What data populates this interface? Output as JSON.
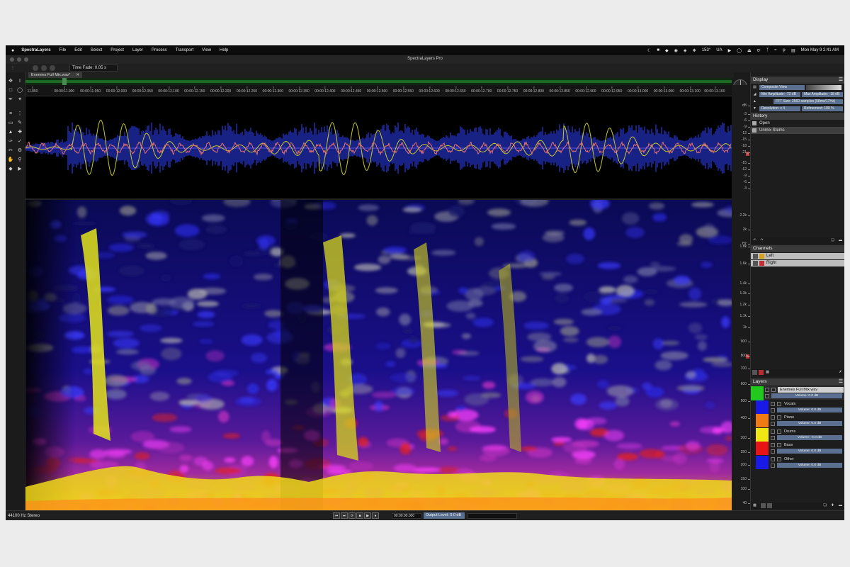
{
  "menubar": {
    "apple": "",
    "app": "SpectraLayers",
    "items": [
      "File",
      "Edit",
      "Select",
      "Project",
      "Layer",
      "Process",
      "Transport",
      "View",
      "Help"
    ],
    "status_temp": "153°",
    "status_input": "UA",
    "clock": "Mon May 9  2:41 AM"
  },
  "window": {
    "title": "SpectraLayers Pro"
  },
  "toolbar": {
    "time_fade": "Time Fade: 0.05 s"
  },
  "file_tab": {
    "name": "Enemies Full Mix.wav*",
    "close": "✕"
  },
  "ruler": {
    "ticks": [
      "11.850",
      "00:00:11.900",
      "00:00:11.950",
      "00:00:12.000",
      "00:00:12.050",
      "00:00:12.100",
      "00:00:12.150",
      "00:00:12.200",
      "00:00:12.250",
      "00:00:12.300",
      "00:00:12.350",
      "00:00:12.400",
      "00:00:12.450",
      "00:00:12.500",
      "00:00:12.550",
      "00:00:12.600",
      "00:00:12.650",
      "00:00:12.700",
      "00:00:12.750",
      "00:00:12.800",
      "00:00:12.850",
      "00:00:12.900",
      "00:00:12.950",
      "00:00:13.000",
      "00:00:13.050",
      "00:00:13.100",
      "00:00:13.150"
    ]
  },
  "db_axis": {
    "unit": "dB",
    "labels": [
      "-3",
      "-6",
      "-9",
      "-12",
      "-15",
      "-18",
      "-21",
      "-15",
      "-12",
      "-9",
      "-6",
      "-3"
    ]
  },
  "hz_axis": {
    "unit": "Hz",
    "labels": [
      "2.2k",
      "2k",
      "1.8k",
      "1.6k",
      "1.4k",
      "1.3k",
      "1.2k",
      "1.1k",
      "1k",
      "900",
      "800",
      "700",
      "600",
      "500",
      "400",
      "300",
      "250",
      "200",
      "150",
      "100",
      "40"
    ]
  },
  "display": {
    "title": "Display",
    "composite_view": "Composite View",
    "min_amplitude": "Min Amplitude: -72 dB",
    "max_amplitude": "Max Amplitude: -18 dB",
    "fft_size": "FFT Size: 2560 samples (58ms/17Hz)",
    "resolution": "Resolution: x 4",
    "refinement": "Refinement: 100 %"
  },
  "history": {
    "title": "History",
    "items": [
      "Open",
      "Unmix Stems"
    ]
  },
  "channels": {
    "title": "Channels",
    "items": [
      "Left",
      "Right"
    ]
  },
  "layers": {
    "title": "Layers",
    "root": {
      "name": "Enemies Full Mix.wav",
      "volume": "Volume: 0.0 dB",
      "color": "#22c81e"
    },
    "items": [
      {
        "name": "Vocals",
        "volume": "Volume: 0.0 dB",
        "color": "#1a1ae6"
      },
      {
        "name": "Piano",
        "volume": "Volume: 0.0 dB",
        "color": "#f07a14"
      },
      {
        "name": "Drums",
        "volume": "Volume: -4.0 dB",
        "color": "#f0e614"
      },
      {
        "name": "Bass",
        "volume": "Volume: 0.0 dB",
        "color": "#e61414"
      },
      {
        "name": "Other",
        "volume": "Volume: 0.0 dB",
        "color": "#1a1ae6"
      }
    ]
  },
  "bottom": {
    "sample_rate": "44100 Hz Stereo",
    "timecode": "00:00:00.000",
    "output_level": "Output Level: 0.0 dB"
  },
  "icons": [
    "apple-icon",
    "wifi-icon",
    "bluetooth-icon",
    "search-icon",
    "play-icon",
    "stop-icon",
    "record-icon",
    "rewind-icon",
    "forward-icon",
    "loop-icon",
    "menu-icon",
    "trash-icon",
    "undo-icon",
    "redo-icon"
  ]
}
